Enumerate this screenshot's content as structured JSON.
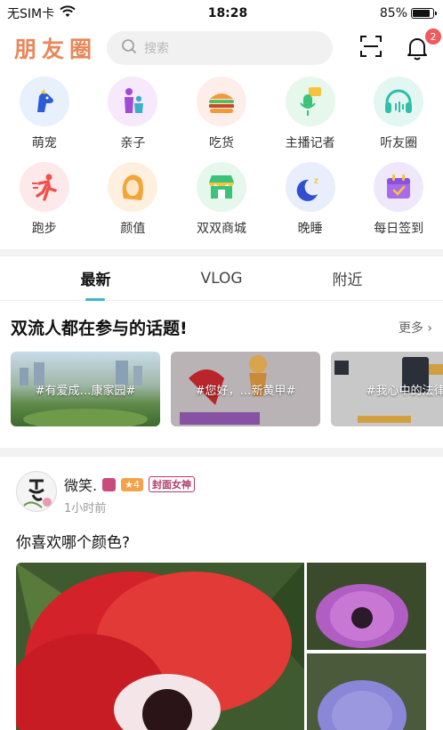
{
  "status": {
    "carrier": "无SIM卡",
    "time": "18:28",
    "battery": "85%",
    "battery_level": 0.85
  },
  "header": {
    "logo": "朋友圈",
    "search_placeholder": "搜索",
    "notification_count": "2"
  },
  "categories": [
    {
      "label": "萌宠",
      "icon": "pet-icon",
      "bg": "#e8f0fb"
    },
    {
      "label": "亲子",
      "icon": "parent-child-icon",
      "bg": "#f7e8fb"
    },
    {
      "label": "吃货",
      "icon": "burger-icon",
      "bg": "#fdeeea"
    },
    {
      "label": "主播记者",
      "icon": "microphone-icon",
      "bg": "#e6f7ec"
    },
    {
      "label": "听友圈",
      "icon": "headphones-icon",
      "bg": "#e3f6f2"
    },
    {
      "label": "跑步",
      "icon": "runner-icon",
      "bg": "#fde8ea"
    },
    {
      "label": "颜值",
      "icon": "face-icon",
      "bg": "#fdf0df"
    },
    {
      "label": "双双商城",
      "icon": "shop-icon",
      "bg": "#e6f7ec"
    },
    {
      "label": "晚睡",
      "icon": "moon-icon",
      "bg": "#e8eefb"
    },
    {
      "label": "每日签到",
      "icon": "calendar-check-icon",
      "bg": "#efe8fb"
    }
  ],
  "tabs": [
    {
      "label": "最新",
      "active": true
    },
    {
      "label": "VLOG",
      "active": false
    },
    {
      "label": "附近",
      "active": false
    }
  ],
  "topics": {
    "title": "双流人都在参与的话题!",
    "more": "更多",
    "items": [
      {
        "label": "#有爱成…康家园#"
      },
      {
        "label": "#您好，…新黄甲#"
      },
      {
        "label": "#我心中的法律"
      }
    ]
  },
  "post": {
    "username": "微笑.",
    "level": "4",
    "tag": "封面女神",
    "time": "1小时前",
    "text": "你喜欢哪个颜色?"
  }
}
